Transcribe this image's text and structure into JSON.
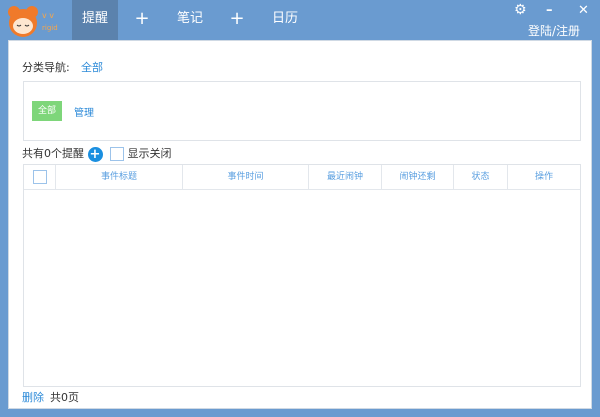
{
  "header": {
    "tabs": [
      {
        "label": "提醒",
        "active": true
      },
      {
        "label": "+"
      },
      {
        "label": "笔记"
      },
      {
        "label": "+"
      },
      {
        "label": "日历"
      }
    ],
    "login": "登陆/注册",
    "settings_icon": "gear-icon",
    "minimize": "–",
    "close": "✕"
  },
  "nav": {
    "label": "分类导航:",
    "current": "全部"
  },
  "categories": {
    "all": "全部",
    "manage": "管理"
  },
  "list": {
    "count_text": "共有0个提醒",
    "show_closed": "显示关闭"
  },
  "table": {
    "columns": [
      "事件标题",
      "事件时间",
      "最近闹钟",
      "闹钟还剩",
      "状态",
      "操作"
    ],
    "rows": []
  },
  "footer": {
    "delete": "删除",
    "pages": "共0页"
  },
  "colors": {
    "titlebar": "#6a9bd0",
    "active_tab": "#5b82ad",
    "accent": "#2c8ad8",
    "green": "#7ed67a"
  }
}
